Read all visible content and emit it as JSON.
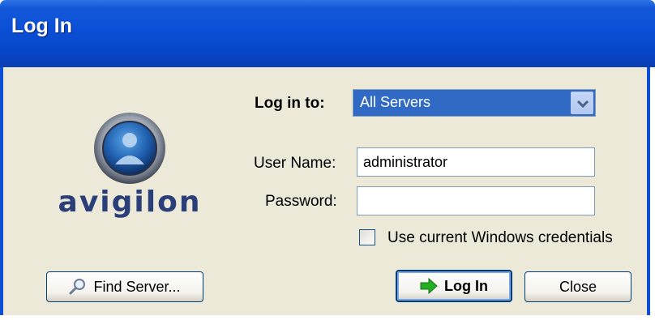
{
  "window": {
    "title": "Log In"
  },
  "brand": {
    "logo_text": "avigilon"
  },
  "form": {
    "log_in_to_label": "Log in to:",
    "log_in_to_value": "All Servers",
    "username_label": "User Name:",
    "username_value": "administrator",
    "password_label": "Password:",
    "password_value": "",
    "windows_credentials_label": "Use current Windows credentials",
    "windows_credentials_checked": false
  },
  "buttons": {
    "find_server": "Find Server...",
    "log_in": "Log In",
    "close": "Close"
  },
  "colors": {
    "titlebar": "#0a4fd6",
    "dialog_bg": "#ece9d8",
    "selection": "#316ac5",
    "brand": "#2a3f7a",
    "login_arrow": "#22b022"
  },
  "icons": {
    "logo": "avigilon-person-globe-icon",
    "dropdown": "chevron-down-icon",
    "find": "magnifier-icon",
    "login": "green-arrow-right-icon"
  }
}
